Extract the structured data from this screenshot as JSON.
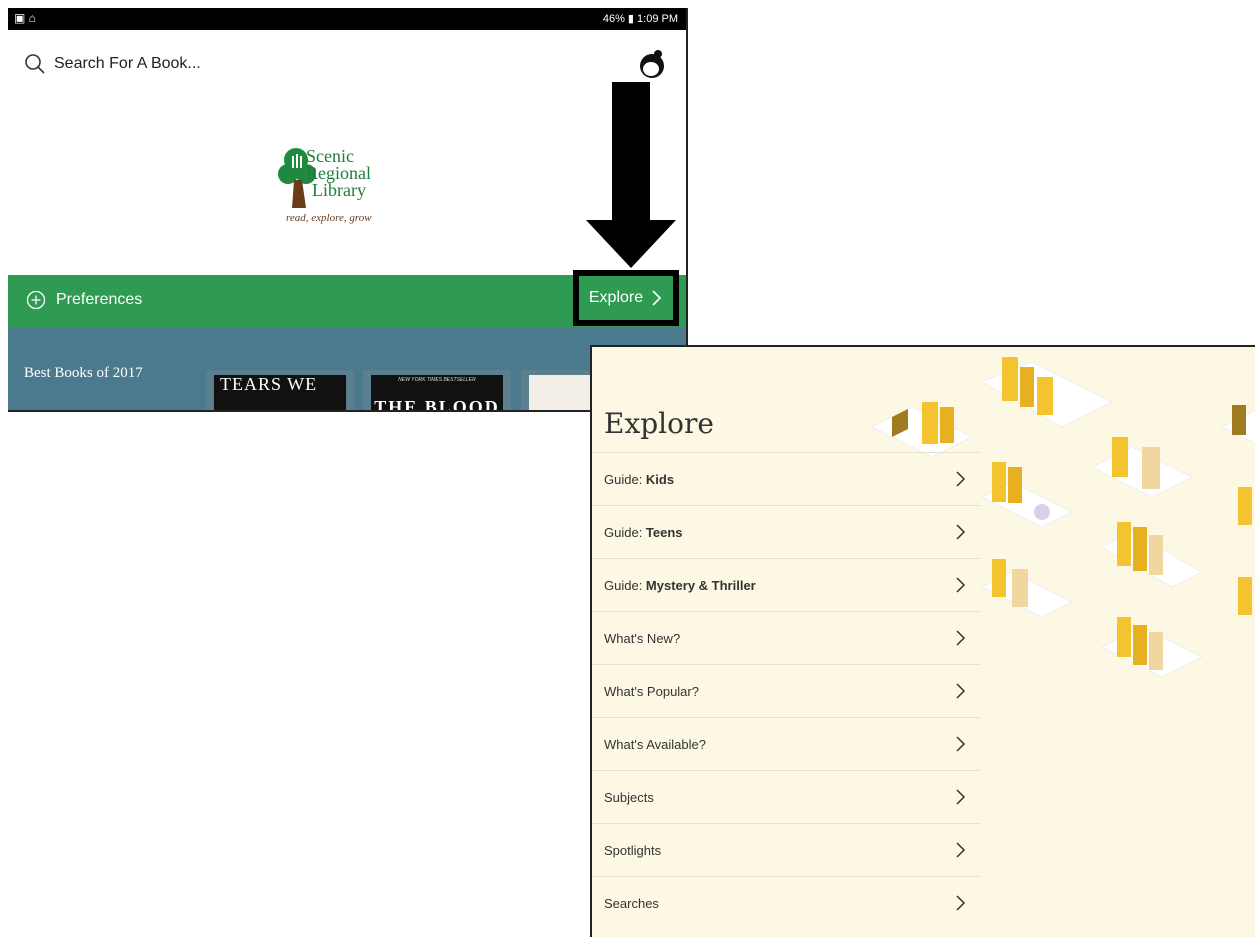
{
  "status_bar": {
    "right_text": "46% ▮ 1:09 PM"
  },
  "search": {
    "placeholder": "Search For A Book..."
  },
  "logo": {
    "line1": "Scenic",
    "line2": "Regional",
    "line3": "Library",
    "tagline": "read, explore, grow"
  },
  "preferences_label": "Preferences",
  "explore_button_label": "Explore",
  "best_books": {
    "title": "Best Books of 2017",
    "cover1_text": "TEARS WE",
    "cover2_banner": "NEW YORK TIMES BESTSELLER",
    "cover2_text": "THE BLOOD OF"
  },
  "explore_panel": {
    "title": "Explore",
    "items": [
      {
        "prefix": "Guide: ",
        "bold": "Kids"
      },
      {
        "prefix": "Guide: ",
        "bold": "Teens"
      },
      {
        "prefix": "Guide: ",
        "bold": "Mystery & Thriller"
      },
      {
        "prefix": "What's New?",
        "bold": ""
      },
      {
        "prefix": "What's Popular?",
        "bold": ""
      },
      {
        "prefix": "What's Available?",
        "bold": ""
      },
      {
        "prefix": "Subjects",
        "bold": ""
      },
      {
        "prefix": "Spotlights",
        "bold": ""
      },
      {
        "prefix": "Searches",
        "bold": ""
      }
    ]
  },
  "colors": {
    "green_bar": "#2e9a52",
    "best_books_bg": "#4b7a8e",
    "panel_bg": "#fdf8e4"
  }
}
